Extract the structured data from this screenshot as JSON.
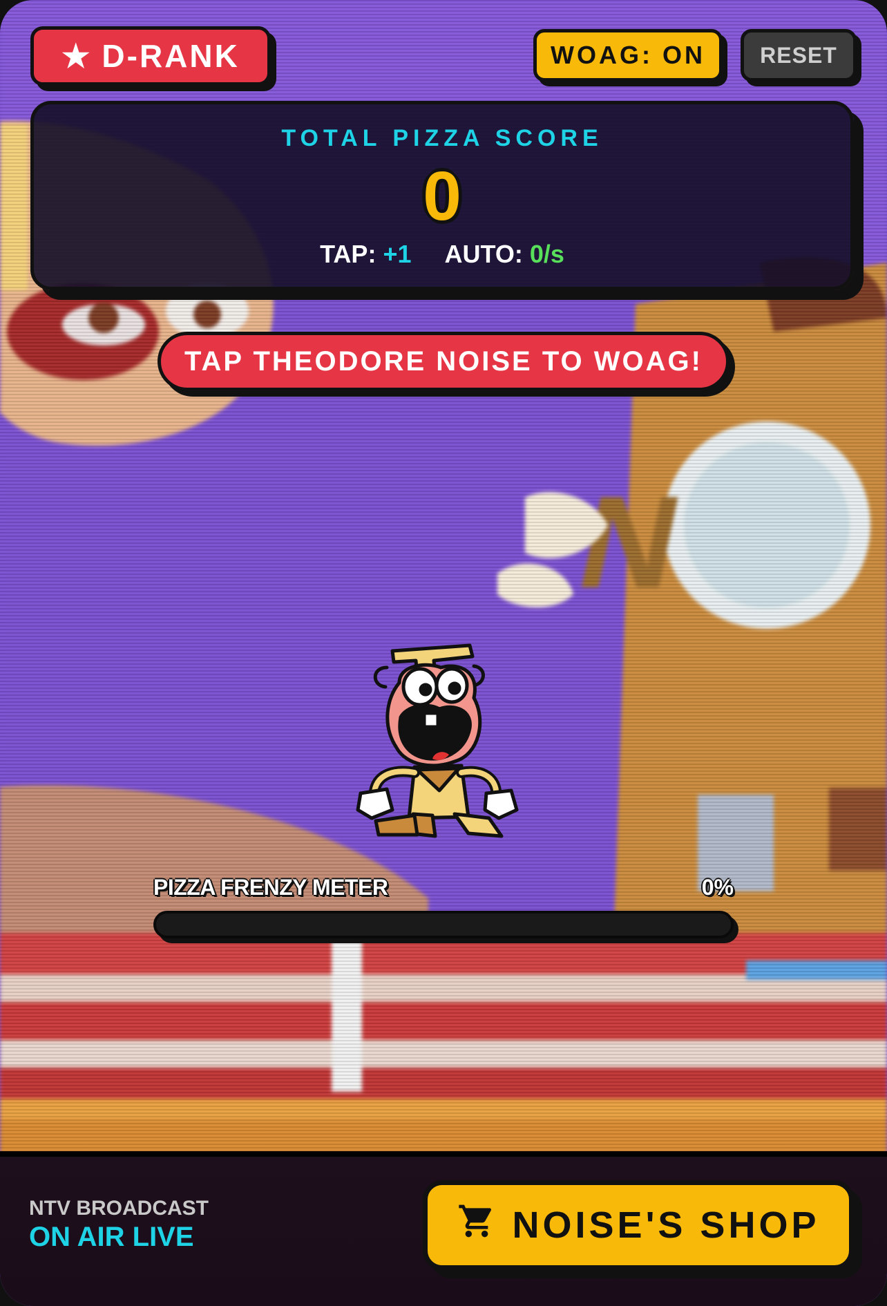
{
  "header": {
    "rank_label": "D-RANK",
    "woag_toggle_label": "WOAG: ON",
    "reset_label": "RESET"
  },
  "score": {
    "title": "TOTAL PIZZA SCORE",
    "value": "0",
    "tap_label": "TAP:",
    "tap_value": "+1",
    "auto_label": "AUTO:",
    "auto_value": "0/s"
  },
  "banner": {
    "instruction": "TAP THEODORE NOISE TO WOAG!"
  },
  "frenzy": {
    "label": "PIZZA FRENZY METER",
    "percent_text": "0%",
    "level": 0
  },
  "footer": {
    "broadcast_label": "NTV BROADCAST",
    "status": "ON AIR LIVE",
    "shop_label": "NOISE'S SHOP"
  },
  "icons": {
    "rank": "star-icon",
    "shop": "cart-icon"
  },
  "colors": {
    "accent_red": "#e63646",
    "accent_yellow": "#f8b908",
    "accent_cyan": "#1fd3e6",
    "accent_green": "#58e05b"
  }
}
